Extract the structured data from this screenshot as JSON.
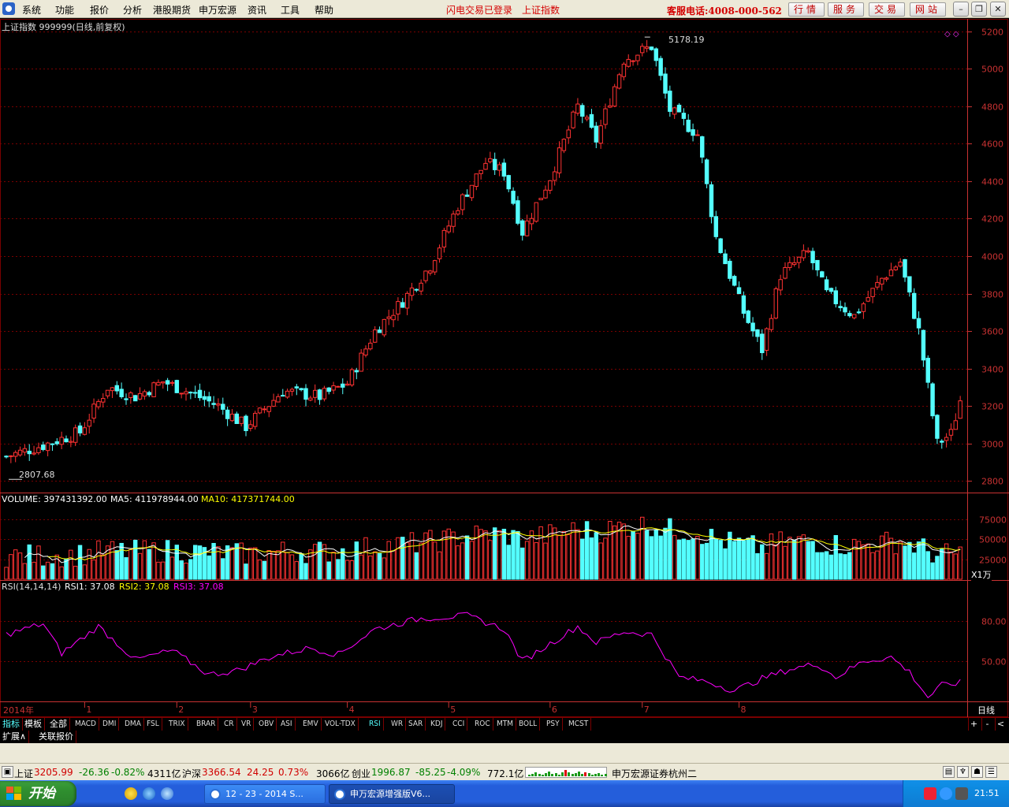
{
  "menubar": {
    "items": [
      "系统",
      "功能",
      "报价",
      "分析",
      "港股期货",
      "申万宏源",
      "资讯",
      "工具",
      "帮助"
    ],
    "status_login": "闪电交易已登录",
    "status_index": "上证指数",
    "hotline": "客服电话:4008-000-562",
    "buttons": [
      "行情",
      "服务",
      "交易",
      "网站"
    ],
    "window_controls": [
      "minimize-icon",
      "restore-icon",
      "close-icon"
    ]
  },
  "chart": {
    "title": "上证指数 999999(日线,前复权)",
    "high_label": "5178.19",
    "low_label": "2807.68",
    "volume_label": "VOLUME: 397431392.00",
    "ma5_label": "MA5: 411978944.00",
    "ma10_label": "MA10: 417371744.00",
    "rsi_label": "RSI(14,14,14)",
    "rsi1_label": "RSI1: 37.08",
    "rsi2_label": "RSI2: 37.08",
    "rsi3_label": "RSI3: 37.08",
    "vol_unit": "X1万",
    "period_label": "日线",
    "year_label": "2014年",
    "month_labels": [
      "1",
      "2",
      "3",
      "4",
      "5",
      "6",
      "7",
      "8"
    ],
    "colors": {
      "up": "#ff3232",
      "down": "#54ffff",
      "ma5": "#ffffff",
      "ma10": "#ffff00",
      "rsi": "#ff00ff",
      "grid": "#7a0000",
      "axis": "#c83232"
    }
  },
  "chart_data": [
    {
      "type": "candlestick",
      "title": "上证指数 999999(日线,前复权)",
      "ylim": [
        2750,
        5250
      ],
      "yticks": [
        2800,
        3000,
        3200,
        3400,
        3600,
        3800,
        4000,
        4200,
        4400,
        4600,
        4800,
        5000,
        5200
      ],
      "annotations": [
        {
          "label": "5178.19",
          "kind": "high"
        },
        {
          "label": "2807.68",
          "kind": "low"
        }
      ],
      "x_labels": [
        "2014年",
        "1",
        "2",
        "3",
        "4",
        "5",
        "6",
        "7",
        "8"
      ],
      "close_anchors": [
        {
          "i": 0,
          "v": 2930
        },
        {
          "i": 8,
          "v": 2990
        },
        {
          "i": 16,
          "v": 3060
        },
        {
          "i": 22,
          "v": 3300
        },
        {
          "i": 28,
          "v": 3250
        },
        {
          "i": 34,
          "v": 3330
        },
        {
          "i": 40,
          "v": 3270
        },
        {
          "i": 46,
          "v": 3200
        },
        {
          "i": 52,
          "v": 3090
        },
        {
          "i": 60,
          "v": 3280
        },
        {
          "i": 68,
          "v": 3250
        },
        {
          "i": 74,
          "v": 3320
        },
        {
          "i": 80,
          "v": 3600
        },
        {
          "i": 86,
          "v": 3760
        },
        {
          "i": 92,
          "v": 3950
        },
        {
          "i": 98,
          "v": 4270
        },
        {
          "i": 104,
          "v": 4500
        },
        {
          "i": 108,
          "v": 4450
        },
        {
          "i": 112,
          "v": 4130
        },
        {
          "i": 118,
          "v": 4420
        },
        {
          "i": 124,
          "v": 4800
        },
        {
          "i": 128,
          "v": 4620
        },
        {
          "i": 134,
          "v": 5050
        },
        {
          "i": 140,
          "v": 5120
        },
        {
          "i": 144,
          "v": 4780
        },
        {
          "i": 150,
          "v": 4650
        },
        {
          "i": 154,
          "v": 4100
        },
        {
          "i": 160,
          "v": 3700
        },
        {
          "i": 164,
          "v": 3500
        },
        {
          "i": 168,
          "v": 3900
        },
        {
          "i": 174,
          "v": 4020
        },
        {
          "i": 178,
          "v": 3800
        },
        {
          "i": 184,
          "v": 3680
        },
        {
          "i": 190,
          "v": 3880
        },
        {
          "i": 194,
          "v": 3970
        },
        {
          "i": 198,
          "v": 3600
        },
        {
          "i": 202,
          "v": 3000
        },
        {
          "i": 205,
          "v": 3050
        },
        {
          "i": 207,
          "v": 3230
        }
      ],
      "n_bars": 208
    },
    {
      "type": "bar",
      "title": "VOLUME",
      "ylim": [
        0,
        90000
      ],
      "yticks": [
        25000,
        50000,
        75000
      ],
      "unit": "X1万",
      "series": [
        {
          "name": "VOLUME"
        },
        {
          "name": "MA5"
        },
        {
          "name": "MA10"
        }
      ]
    },
    {
      "type": "line",
      "title": "RSI(14,14,14)",
      "ylim": [
        20,
        100
      ],
      "yticks": [
        50,
        80
      ],
      "series": [
        {
          "name": "RSI1"
        },
        {
          "name": "RSI2"
        },
        {
          "name": "RSI3"
        }
      ],
      "anchors": [
        {
          "i": 0,
          "v": 70
        },
        {
          "i": 8,
          "v": 78
        },
        {
          "i": 12,
          "v": 56
        },
        {
          "i": 20,
          "v": 76
        },
        {
          "i": 28,
          "v": 51
        },
        {
          "i": 36,
          "v": 58
        },
        {
          "i": 44,
          "v": 40
        },
        {
          "i": 50,
          "v": 43
        },
        {
          "i": 58,
          "v": 54
        },
        {
          "i": 66,
          "v": 60
        },
        {
          "i": 72,
          "v": 55
        },
        {
          "i": 80,
          "v": 74
        },
        {
          "i": 90,
          "v": 82
        },
        {
          "i": 100,
          "v": 84
        },
        {
          "i": 108,
          "v": 74
        },
        {
          "i": 112,
          "v": 50
        },
        {
          "i": 118,
          "v": 63
        },
        {
          "i": 124,
          "v": 76
        },
        {
          "i": 128,
          "v": 64
        },
        {
          "i": 134,
          "v": 72
        },
        {
          "i": 140,
          "v": 70
        },
        {
          "i": 146,
          "v": 38
        },
        {
          "i": 152,
          "v": 35
        },
        {
          "i": 158,
          "v": 28
        },
        {
          "i": 164,
          "v": 37
        },
        {
          "i": 170,
          "v": 44
        },
        {
          "i": 176,
          "v": 48
        },
        {
          "i": 180,
          "v": 38
        },
        {
          "i": 186,
          "v": 50
        },
        {
          "i": 192,
          "v": 53
        },
        {
          "i": 196,
          "v": 42
        },
        {
          "i": 200,
          "v": 23
        },
        {
          "i": 203,
          "v": 32
        },
        {
          "i": 207,
          "v": 34
        }
      ]
    }
  ],
  "indicator_tabs": {
    "groups": [
      "指标",
      "模板",
      "全部"
    ],
    "items": [
      "MACD",
      "DMI",
      "DMA",
      "FSL",
      "TRIX",
      "BRAR",
      "CR",
      "VR",
      "OBV",
      "ASI",
      "EMV",
      "VOL-TDX",
      "RSI",
      "WR",
      "SAR",
      "KDJ",
      "CCI",
      "ROC",
      "MTM",
      "BOLL",
      "PSY",
      "MCST"
    ],
    "active": "RSI",
    "controls": [
      "+",
      "-",
      "<"
    ]
  },
  "sub_tabs": [
    "扩展∧",
    "关联报价"
  ],
  "ticker": {
    "sh_name": "上证",
    "sh_value": "3205.99",
    "sh_change": "-26.36",
    "sh_pct": "-0.82%",
    "sh_amount": "4311亿",
    "hs_name": "沪深",
    "hs_value": "3366.54",
    "hs_change": "24.25",
    "hs_pct": "0.73%",
    "hs_amount": "3066亿",
    "cy_name": "创业",
    "cy_value": "1996.87",
    "cy_change": "-85.25",
    "cy_pct": "-4.09%",
    "cy_amount": "772.1亿",
    "broker": "申万宏源证券杭州二"
  },
  "taskbar": {
    "start_label": "开始",
    "tasks": [
      "12 - 23 - 2014 S...",
      "申万宏源增强版V6..."
    ],
    "clock": "21:51"
  }
}
